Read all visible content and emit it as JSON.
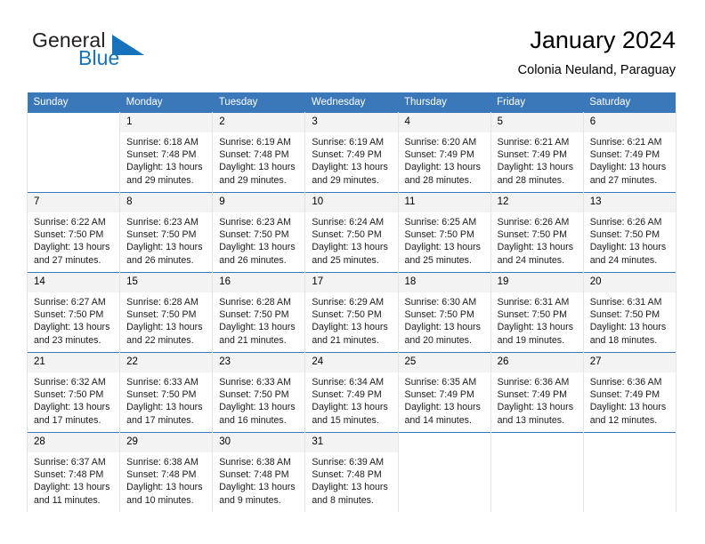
{
  "brand": {
    "word_general": "General",
    "word_blue": "Blue",
    "triangle_color": "#1673bb"
  },
  "header": {
    "title": "January 2024",
    "subtitle": "Colonia Neuland, Paraguay",
    "header_bg": "#3b78ba",
    "daynum_bg": "#f3f3f3"
  },
  "weekdays": [
    "Sunday",
    "Monday",
    "Tuesday",
    "Wednesday",
    "Thursday",
    "Friday",
    "Saturday"
  ],
  "weeks": [
    [
      {
        "day": "",
        "sunrise": "",
        "sunset": "",
        "daylight": "",
        "daylight2": ""
      },
      {
        "day": "1",
        "sunrise": "Sunrise: 6:18 AM",
        "sunset": "Sunset: 7:48 PM",
        "daylight": "Daylight: 13 hours",
        "daylight2": "and 29 minutes."
      },
      {
        "day": "2",
        "sunrise": "Sunrise: 6:19 AM",
        "sunset": "Sunset: 7:48 PM",
        "daylight": "Daylight: 13 hours",
        "daylight2": "and 29 minutes."
      },
      {
        "day": "3",
        "sunrise": "Sunrise: 6:19 AM",
        "sunset": "Sunset: 7:49 PM",
        "daylight": "Daylight: 13 hours",
        "daylight2": "and 29 minutes."
      },
      {
        "day": "4",
        "sunrise": "Sunrise: 6:20 AM",
        "sunset": "Sunset: 7:49 PM",
        "daylight": "Daylight: 13 hours",
        "daylight2": "and 28 minutes."
      },
      {
        "day": "5",
        "sunrise": "Sunrise: 6:21 AM",
        "sunset": "Sunset: 7:49 PM",
        "daylight": "Daylight: 13 hours",
        "daylight2": "and 28 minutes."
      },
      {
        "day": "6",
        "sunrise": "Sunrise: 6:21 AM",
        "sunset": "Sunset: 7:49 PM",
        "daylight": "Daylight: 13 hours",
        "daylight2": "and 27 minutes."
      }
    ],
    [
      {
        "day": "7",
        "sunrise": "Sunrise: 6:22 AM",
        "sunset": "Sunset: 7:50 PM",
        "daylight": "Daylight: 13 hours",
        "daylight2": "and 27 minutes."
      },
      {
        "day": "8",
        "sunrise": "Sunrise: 6:23 AM",
        "sunset": "Sunset: 7:50 PM",
        "daylight": "Daylight: 13 hours",
        "daylight2": "and 26 minutes."
      },
      {
        "day": "9",
        "sunrise": "Sunrise: 6:23 AM",
        "sunset": "Sunset: 7:50 PM",
        "daylight": "Daylight: 13 hours",
        "daylight2": "and 26 minutes."
      },
      {
        "day": "10",
        "sunrise": "Sunrise: 6:24 AM",
        "sunset": "Sunset: 7:50 PM",
        "daylight": "Daylight: 13 hours",
        "daylight2": "and 25 minutes."
      },
      {
        "day": "11",
        "sunrise": "Sunrise: 6:25 AM",
        "sunset": "Sunset: 7:50 PM",
        "daylight": "Daylight: 13 hours",
        "daylight2": "and 25 minutes."
      },
      {
        "day": "12",
        "sunrise": "Sunrise: 6:26 AM",
        "sunset": "Sunset: 7:50 PM",
        "daylight": "Daylight: 13 hours",
        "daylight2": "and 24 minutes."
      },
      {
        "day": "13",
        "sunrise": "Sunrise: 6:26 AM",
        "sunset": "Sunset: 7:50 PM",
        "daylight": "Daylight: 13 hours",
        "daylight2": "and 24 minutes."
      }
    ],
    [
      {
        "day": "14",
        "sunrise": "Sunrise: 6:27 AM",
        "sunset": "Sunset: 7:50 PM",
        "daylight": "Daylight: 13 hours",
        "daylight2": "and 23 minutes."
      },
      {
        "day": "15",
        "sunrise": "Sunrise: 6:28 AM",
        "sunset": "Sunset: 7:50 PM",
        "daylight": "Daylight: 13 hours",
        "daylight2": "and 22 minutes."
      },
      {
        "day": "16",
        "sunrise": "Sunrise: 6:28 AM",
        "sunset": "Sunset: 7:50 PM",
        "daylight": "Daylight: 13 hours",
        "daylight2": "and 21 minutes."
      },
      {
        "day": "17",
        "sunrise": "Sunrise: 6:29 AM",
        "sunset": "Sunset: 7:50 PM",
        "daylight": "Daylight: 13 hours",
        "daylight2": "and 21 minutes."
      },
      {
        "day": "18",
        "sunrise": "Sunrise: 6:30 AM",
        "sunset": "Sunset: 7:50 PM",
        "daylight": "Daylight: 13 hours",
        "daylight2": "and 20 minutes."
      },
      {
        "day": "19",
        "sunrise": "Sunrise: 6:31 AM",
        "sunset": "Sunset: 7:50 PM",
        "daylight": "Daylight: 13 hours",
        "daylight2": "and 19 minutes."
      },
      {
        "day": "20",
        "sunrise": "Sunrise: 6:31 AM",
        "sunset": "Sunset: 7:50 PM",
        "daylight": "Daylight: 13 hours",
        "daylight2": "and 18 minutes."
      }
    ],
    [
      {
        "day": "21",
        "sunrise": "Sunrise: 6:32 AM",
        "sunset": "Sunset: 7:50 PM",
        "daylight": "Daylight: 13 hours",
        "daylight2": "and 17 minutes."
      },
      {
        "day": "22",
        "sunrise": "Sunrise: 6:33 AM",
        "sunset": "Sunset: 7:50 PM",
        "daylight": "Daylight: 13 hours",
        "daylight2": "and 17 minutes."
      },
      {
        "day": "23",
        "sunrise": "Sunrise: 6:33 AM",
        "sunset": "Sunset: 7:50 PM",
        "daylight": "Daylight: 13 hours",
        "daylight2": "and 16 minutes."
      },
      {
        "day": "24",
        "sunrise": "Sunrise: 6:34 AM",
        "sunset": "Sunset: 7:49 PM",
        "daylight": "Daylight: 13 hours",
        "daylight2": "and 15 minutes."
      },
      {
        "day": "25",
        "sunrise": "Sunrise: 6:35 AM",
        "sunset": "Sunset: 7:49 PM",
        "daylight": "Daylight: 13 hours",
        "daylight2": "and 14 minutes."
      },
      {
        "day": "26",
        "sunrise": "Sunrise: 6:36 AM",
        "sunset": "Sunset: 7:49 PM",
        "daylight": "Daylight: 13 hours",
        "daylight2": "and 13 minutes."
      },
      {
        "day": "27",
        "sunrise": "Sunrise: 6:36 AM",
        "sunset": "Sunset: 7:49 PM",
        "daylight": "Daylight: 13 hours",
        "daylight2": "and 12 minutes."
      }
    ],
    [
      {
        "day": "28",
        "sunrise": "Sunrise: 6:37 AM",
        "sunset": "Sunset: 7:48 PM",
        "daylight": "Daylight: 13 hours",
        "daylight2": "and 11 minutes."
      },
      {
        "day": "29",
        "sunrise": "Sunrise: 6:38 AM",
        "sunset": "Sunset: 7:48 PM",
        "daylight": "Daylight: 13 hours",
        "daylight2": "and 10 minutes."
      },
      {
        "day": "30",
        "sunrise": "Sunrise: 6:38 AM",
        "sunset": "Sunset: 7:48 PM",
        "daylight": "Daylight: 13 hours",
        "daylight2": "and 9 minutes."
      },
      {
        "day": "31",
        "sunrise": "Sunrise: 6:39 AM",
        "sunset": "Sunset: 7:48 PM",
        "daylight": "Daylight: 13 hours",
        "daylight2": "and 8 minutes."
      },
      {
        "day": "",
        "sunrise": "",
        "sunset": "",
        "daylight": "",
        "daylight2": ""
      },
      {
        "day": "",
        "sunrise": "",
        "sunset": "",
        "daylight": "",
        "daylight2": ""
      },
      {
        "day": "",
        "sunrise": "",
        "sunset": "",
        "daylight": "",
        "daylight2": ""
      }
    ]
  ]
}
